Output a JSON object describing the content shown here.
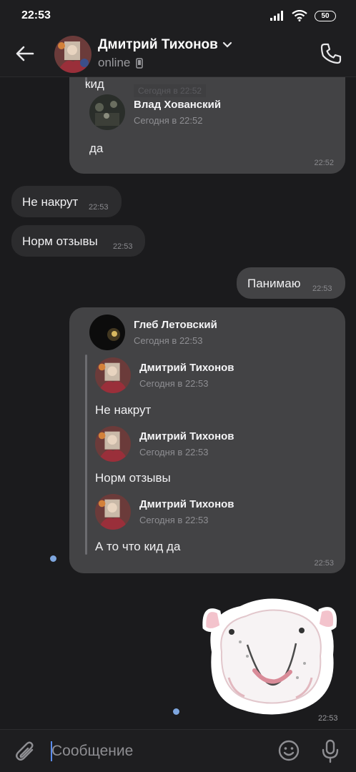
{
  "status_bar": {
    "time": "22:53",
    "battery": "50"
  },
  "header": {
    "contact_name": "Дмитрий Тихонов",
    "status": "online"
  },
  "messages": {
    "top_partial": {
      "line1": "кид",
      "ghost_text": "Сегодня в 22:52",
      "author": "Влад Хованский",
      "date": "Сегодня в 22:52",
      "text": "да",
      "time": "22:52"
    },
    "in1": {
      "text": "Не накрут",
      "time": "22:53"
    },
    "in2": {
      "text": "Норм отзывы",
      "time": "22:53"
    },
    "out1": {
      "text": "Панимаю",
      "time": "22:53"
    },
    "forwarded": {
      "outer_author": "Глеб Летовский",
      "outer_date": "Сегодня в 22:53",
      "items": [
        {
          "author": "Дмитрий Тихонов",
          "date": "Сегодня в 22:53",
          "text": "Не накрут"
        },
        {
          "author": "Дмитрий Тихонов",
          "date": "Сегодня в 22:53",
          "text": "Норм отзывы"
        },
        {
          "author": "Дмитрий Тихонов",
          "date": "Сегодня в 22:53",
          "text": "А то что кид да"
        }
      ],
      "time": "22:53"
    },
    "sticker": {
      "time": "22:53"
    }
  },
  "composer": {
    "placeholder": "Сообщение"
  },
  "colors": {
    "background": "#1b1b1d",
    "outgoing_bubble": "#434345",
    "incoming_bubble": "#2c2c2e",
    "unread_dot": "#7ea6de",
    "caret": "#5b8def"
  }
}
